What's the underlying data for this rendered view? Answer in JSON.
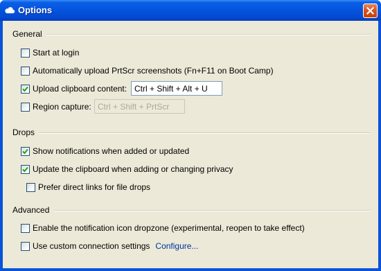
{
  "window": {
    "title": "Options",
    "icon": "cloud-icon",
    "close_icon": "close-icon"
  },
  "sections": {
    "general": {
      "title": "General",
      "start_at_login": {
        "label": "Start at login",
        "checked": false
      },
      "auto_upload_prtscr": {
        "label": "Automatically upload PrtScr screenshots (Fn+F11 on Boot Camp)",
        "checked": false
      },
      "upload_clipboard": {
        "label": "Upload clipboard content:",
        "checked": true,
        "shortcut": "Ctrl + Shift + Alt + U"
      },
      "region_capture": {
        "label": "Region capture:",
        "checked": false,
        "shortcut": "Ctrl + Shift + PrtScr",
        "shortcut_enabled": false
      }
    },
    "drops": {
      "title": "Drops",
      "show_notifications": {
        "label": "Show notifications when added or updated",
        "checked": true
      },
      "update_clipboard": {
        "label": "Update the clipboard when adding or changing privacy",
        "checked": true
      },
      "prefer_direct_links": {
        "label": "Prefer direct links for file drops",
        "checked": false
      }
    },
    "advanced": {
      "title": "Advanced",
      "notification_dropzone": {
        "label": "Enable the notification icon dropzone (experimental, reopen to take effect)",
        "checked": false
      },
      "custom_connection": {
        "label": "Use custom connection settings",
        "checked": false,
        "configure_link": "Configure..."
      }
    }
  },
  "colors": {
    "titlebar": "#0553dd",
    "client_bg": "#ece9d8",
    "link": "#0033a0",
    "close_button": "#d9541f"
  }
}
